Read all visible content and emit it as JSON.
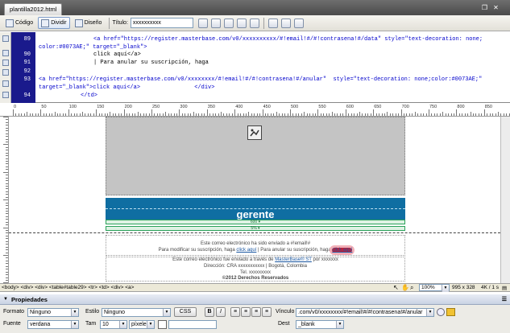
{
  "document": {
    "tab_title": "plantilla2012.html"
  },
  "toolbar": {
    "code_label": "Código",
    "split_label": "Dividir",
    "design_label": "Diseño",
    "title_label": "Título:",
    "title_value": "xxxxxxxxxx"
  },
  "code": {
    "lines": [
      {
        "num": "",
        "text": "<a href=\"https://register.masterbase.com/v0/xxxxxxxxxx/#!email!#/#!contrasena!#/data\" style=\"text-decoration: none;"
      },
      {
        "num": "89",
        "text": "color:#0073AE;\" target=\"_blank\">"
      },
      {
        "num": "90",
        "text": "click aquí</a>"
      },
      {
        "num": "91",
        "text": "| Para anular su suscripción, haga"
      },
      {
        "num": "92",
        "text": ""
      },
      {
        "num": "93",
        "text": "<a href=\"https://register.masterbase.com/v0/xxxxxxxx/#!email!#/#!contrasena!#/anular\"  style=\"text-decoration: none;color:#0073AE;\""
      },
      {
        "num": "",
        "text": "target=\"_blank\">click aquí</a>                </div>"
      },
      {
        "num": "94",
        "text": "</td>"
      }
    ]
  },
  "ruler": {
    "labels": [
      "0",
      "50",
      "100",
      "150",
      "200",
      "250",
      "300",
      "350",
      "400",
      "450",
      "500",
      "550",
      "600",
      "650",
      "700",
      "750",
      "800",
      "850"
    ]
  },
  "design": {
    "banner_text": "gerente",
    "measure_600": "600 ▾",
    "measure_5pct": "5% ▾",
    "footer_line1": "Este correo electrónico ha sido enviado a #!email!#",
    "footer_line2_pre": "Para modificar su suscripción, haga",
    "footer_link1": "click aquí",
    "footer_line2_mid": "| Para anular su suscripción, haga",
    "footer_link2": "click aquí",
    "footer_line3_pre": "Este correo electrónico fue enviado a través de",
    "footer_brand": "MasterBase® ST",
    "footer_line3_post": "por xxxxxxx",
    "footer_line4": "Dirección: CRA xxxxxxxxxxx | Bogotá, Colombia",
    "footer_line5": "Tel. xxxxxxxxx",
    "footer_line6": "©2012 Derechos Reservados"
  },
  "status": {
    "tags": "<body> <div> <div> <table#table29> <tr> <td> <div> <a>",
    "zoom": "100%",
    "dimensions": "995 x 328",
    "size": "4K / 1 s"
  },
  "properties": {
    "title": "Propiedades",
    "format_label": "Formato",
    "format_value": "Ninguno",
    "style_label": "Estilo",
    "style_value": "Ninguno",
    "css_label": "CSS",
    "bold_label": "B",
    "italic_label": "I",
    "link_label": "Vínculo",
    "link_value": ".com/v0/xxxxxxxx/#!email!#/#!contrasena!#/anular",
    "font_label": "Fuente",
    "font_value": "verdana",
    "size_label": "Tam",
    "size_value": "10",
    "unit_value": "píxele",
    "target_label": "Dest",
    "target_value": "_blank"
  }
}
